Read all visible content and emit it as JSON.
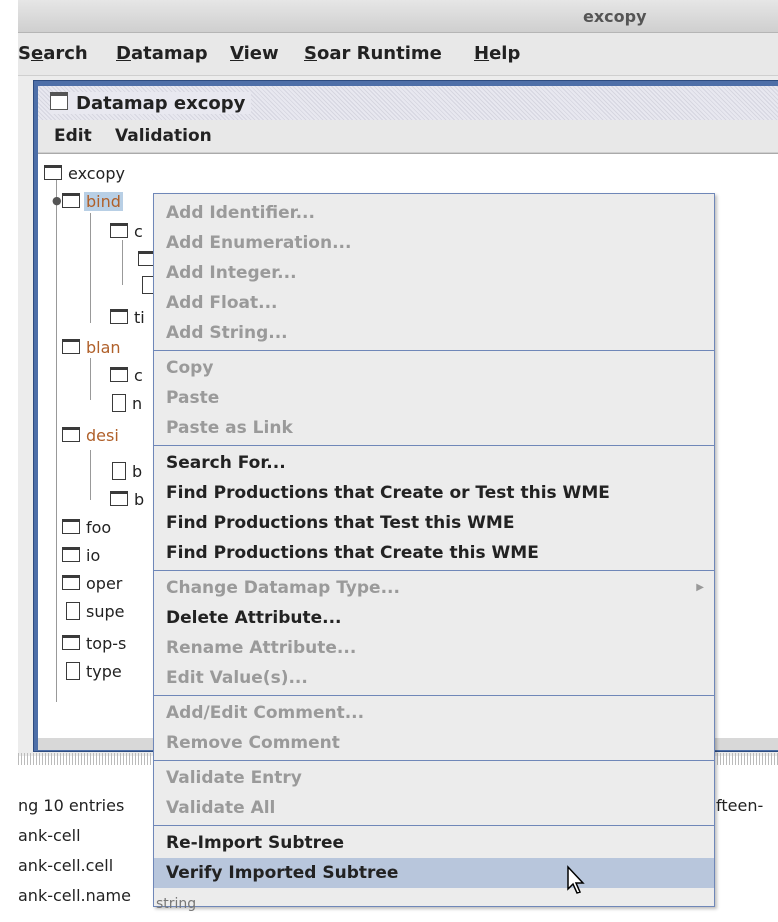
{
  "window": {
    "title": "excopy"
  },
  "menubar": [
    {
      "label": "Search",
      "hotkey": "a"
    },
    {
      "label": "Datamap",
      "hotkey": "D"
    },
    {
      "label": "View",
      "hotkey": "V"
    },
    {
      "label": "Soar Runtime",
      "hotkey": "S"
    },
    {
      "label": "Help",
      "hotkey": "H"
    }
  ],
  "frame": {
    "title": "Datamap excopy",
    "menus": [
      "Edit",
      "Validation"
    ]
  },
  "tree": {
    "root": "excopy",
    "nodes": [
      {
        "label": "bind",
        "selected": true,
        "color": "orange"
      },
      {
        "label": "c"
      },
      {
        "label": ""
      },
      {
        "label": ""
      },
      {
        "label": "ti"
      },
      {
        "label": "blan",
        "color": "orange"
      },
      {
        "label": "c"
      },
      {
        "label": "n"
      },
      {
        "label": "desi",
        "color": "orange"
      },
      {
        "label": "b"
      },
      {
        "label": "b"
      },
      {
        "label": "foo"
      },
      {
        "label": "io"
      },
      {
        "label": "oper"
      },
      {
        "label": "supe"
      },
      {
        "label": "top-s"
      },
      {
        "label": "type"
      }
    ]
  },
  "context_menu": {
    "groups": [
      [
        {
          "label": "Add Identifier...",
          "enabled": false
        },
        {
          "label": "Add Enumeration...",
          "enabled": false
        },
        {
          "label": "Add Integer...",
          "enabled": false
        },
        {
          "label": "Add Float...",
          "enabled": false
        },
        {
          "label": "Add String...",
          "enabled": false
        }
      ],
      [
        {
          "label": "Copy",
          "enabled": false
        },
        {
          "label": "Paste",
          "enabled": false
        },
        {
          "label": "Paste as Link",
          "enabled": false
        }
      ],
      [
        {
          "label": "Search For...",
          "enabled": true
        },
        {
          "label": "Find Productions that Create or Test this WME",
          "enabled": true
        },
        {
          "label": "Find Productions that Test this WME",
          "enabled": true
        },
        {
          "label": "Find Productions that Create this WME",
          "enabled": true
        }
      ],
      [
        {
          "label": "Change Datamap Type...",
          "enabled": false,
          "submenu": true
        },
        {
          "label": "Delete Attribute...",
          "enabled": true
        },
        {
          "label": "Rename Attribute...",
          "enabled": false
        },
        {
          "label": "Edit Value(s)...",
          "enabled": false
        }
      ],
      [
        {
          "label": "Add/Edit Comment...",
          "enabled": false
        },
        {
          "label": "Remove Comment",
          "enabled": false
        }
      ],
      [
        {
          "label": "Validate Entry",
          "enabled": false
        },
        {
          "label": "Validate All",
          "enabled": false
        }
      ],
      [
        {
          "label": "Re-Import Subtree",
          "enabled": true
        },
        {
          "label": "Verify Imported Subtree",
          "enabled": true,
          "highlighted": true
        }
      ]
    ]
  },
  "output": {
    "line1": "ng 10 entries",
    "line1_right": "fteen-",
    "line2": "ank-cell",
    "line3": "ank-cell.cell",
    "line4": "ank-cell.name",
    "line4_tail": "string"
  }
}
